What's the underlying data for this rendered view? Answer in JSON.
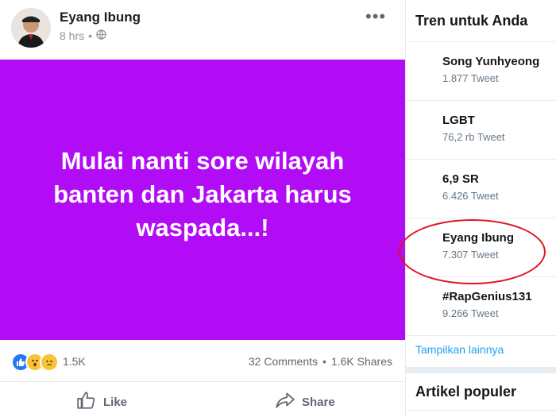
{
  "post": {
    "author": "Eyang Ibung",
    "time": "8 hrs",
    "separator": "•",
    "more": "•••",
    "image_text": "Mulai nanti sore wilayah banten dan Jakarta harus waspada...!",
    "image_bg_color": "#b10cf5",
    "reactions_count": "1.5K",
    "comments": "32 Comments",
    "stats_sep": "•",
    "shares": "1.6K Shares",
    "like_label": "Like",
    "share_label": "Share"
  },
  "trends": {
    "title": "Tren untuk Anda",
    "items": [
      {
        "name": "Song Yunhyeong",
        "count": "1.877 Tweet"
      },
      {
        "name": "LGBT",
        "count": "76,2 rb Tweet"
      },
      {
        "name": "6,9 SR",
        "count": "6.426 Tweet"
      },
      {
        "name": "Eyang Ibung",
        "count": "7.307 Tweet"
      },
      {
        "name": "#RapGenius131",
        "count": "9.266 Tweet"
      }
    ],
    "show_more": "Tampilkan lainnya",
    "section2_title": "Artikel populer",
    "highlight_color": "#e0141e"
  }
}
